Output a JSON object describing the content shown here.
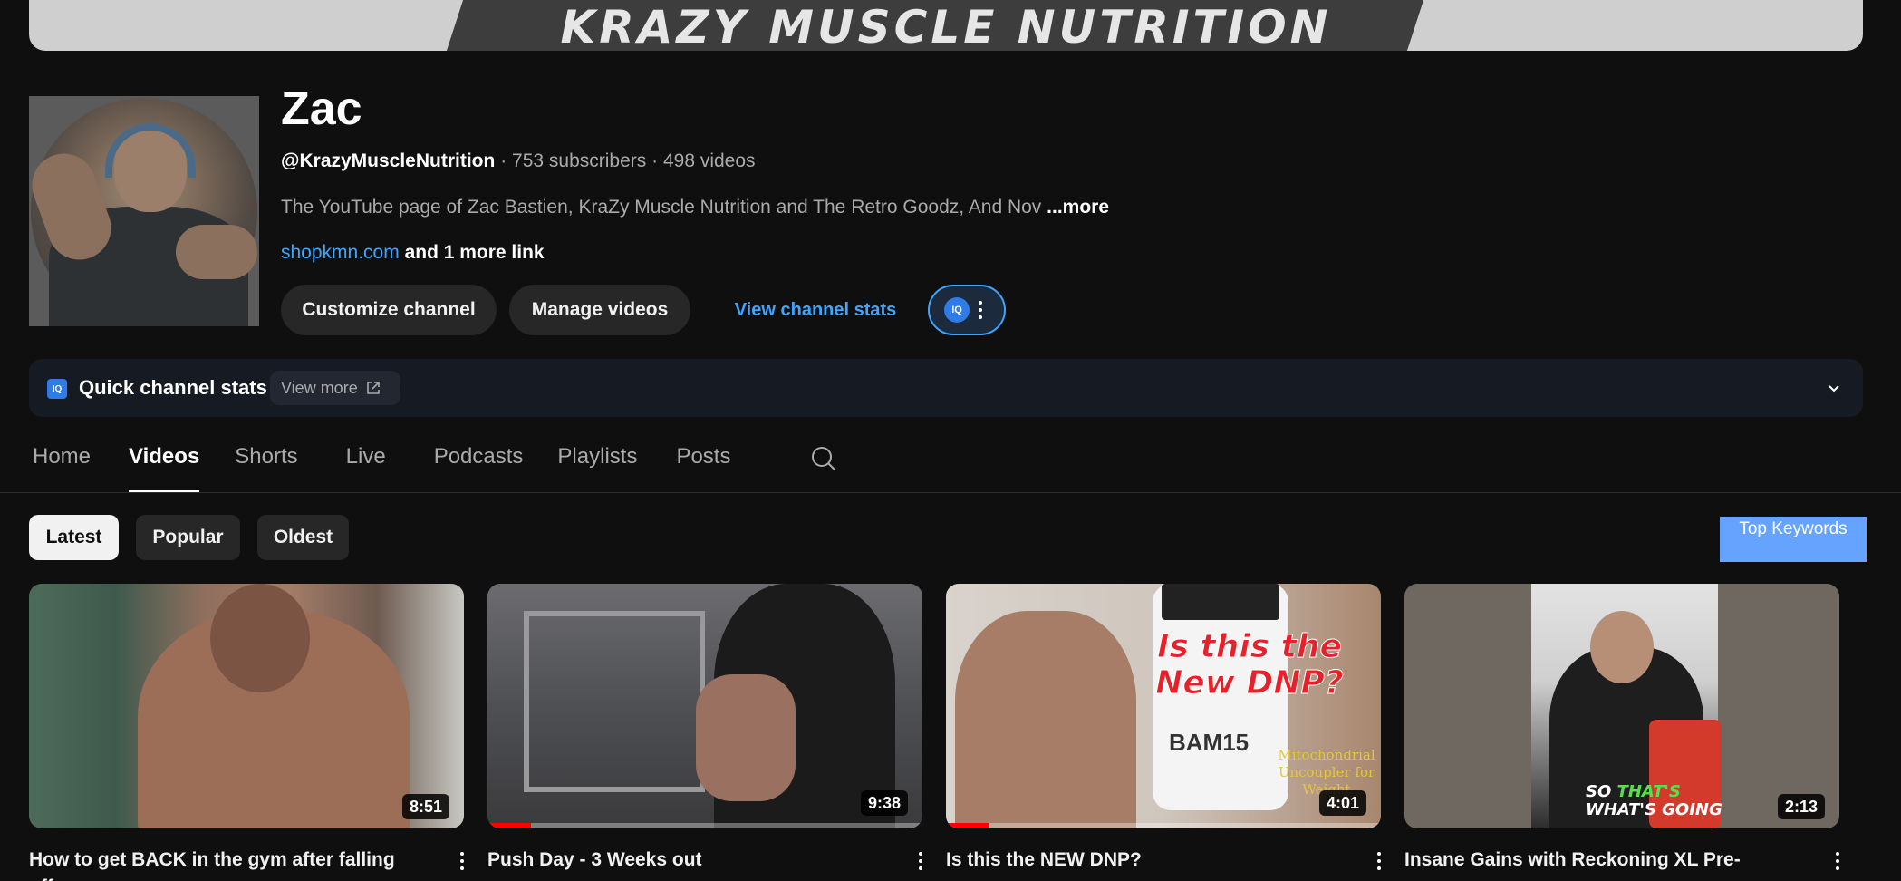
{
  "banner": {
    "text": "KRAZY MUSCLE NUTRITION"
  },
  "channel": {
    "name": "Zac",
    "handle": "@KrazyMuscleNutrition",
    "subscribers": "753 subscribers",
    "videos_count": "498 videos",
    "separator": "·",
    "description": "The YouTube page of Zac Bastien, KraZy Muscle Nutrition and The Retro Goodz, And Nov",
    "description_more": "...more",
    "link_url": "shopkmn.com",
    "link_extra": "and 1 more link"
  },
  "actions": {
    "customize": "Customize channel",
    "manage": "Manage videos",
    "view_stats": "View channel stats",
    "iq_logo": "IQ"
  },
  "quick_stats": {
    "logo": "IQ",
    "title": "Quick channel stats",
    "view_more": "View more"
  },
  "tabs": [
    {
      "label": "Home"
    },
    {
      "label": "Videos"
    },
    {
      "label": "Shorts"
    },
    {
      "label": "Live"
    },
    {
      "label": "Podcasts"
    },
    {
      "label": "Playlists"
    },
    {
      "label": "Posts"
    }
  ],
  "active_tab": "Videos",
  "filters": [
    {
      "label": "Latest"
    },
    {
      "label": "Popular"
    },
    {
      "label": "Oldest"
    }
  ],
  "active_filter": "Latest",
  "top_keywords": "Top Keywords",
  "videos": [
    {
      "title": "How to get BACK in the gym after falling off",
      "duration": "8:51",
      "progress": 0
    },
    {
      "title": "Push Day - 3 Weeks out",
      "duration": "9:38",
      "progress": 0.1
    },
    {
      "title": "Is this the NEW DNP?",
      "duration": "4:01",
      "progress": 0.1,
      "thumb_text": "Is this the New DNP?",
      "thumb_product": "BAM15",
      "thumb_note": "Mitochondrial Uncoupler for Weight"
    },
    {
      "title": "Insane Gains with Reckoning XL Pre-",
      "duration": "2:13",
      "progress": 0,
      "thumb_caption_a": "SO",
      "thumb_caption_b": "THAT'S",
      "thumb_caption_c": "WHAT'S GOING"
    }
  ],
  "colors": {
    "background": "#0f0f0f",
    "link": "#3ea6ff",
    "chip": "#272727",
    "top_keywords": "#65a3ff",
    "progress": "#ff0000"
  },
  "icons": {
    "search": "search-icon",
    "external": "external-link-icon",
    "chevron": "chevron-down-icon",
    "more": "more-vert-icon"
  }
}
